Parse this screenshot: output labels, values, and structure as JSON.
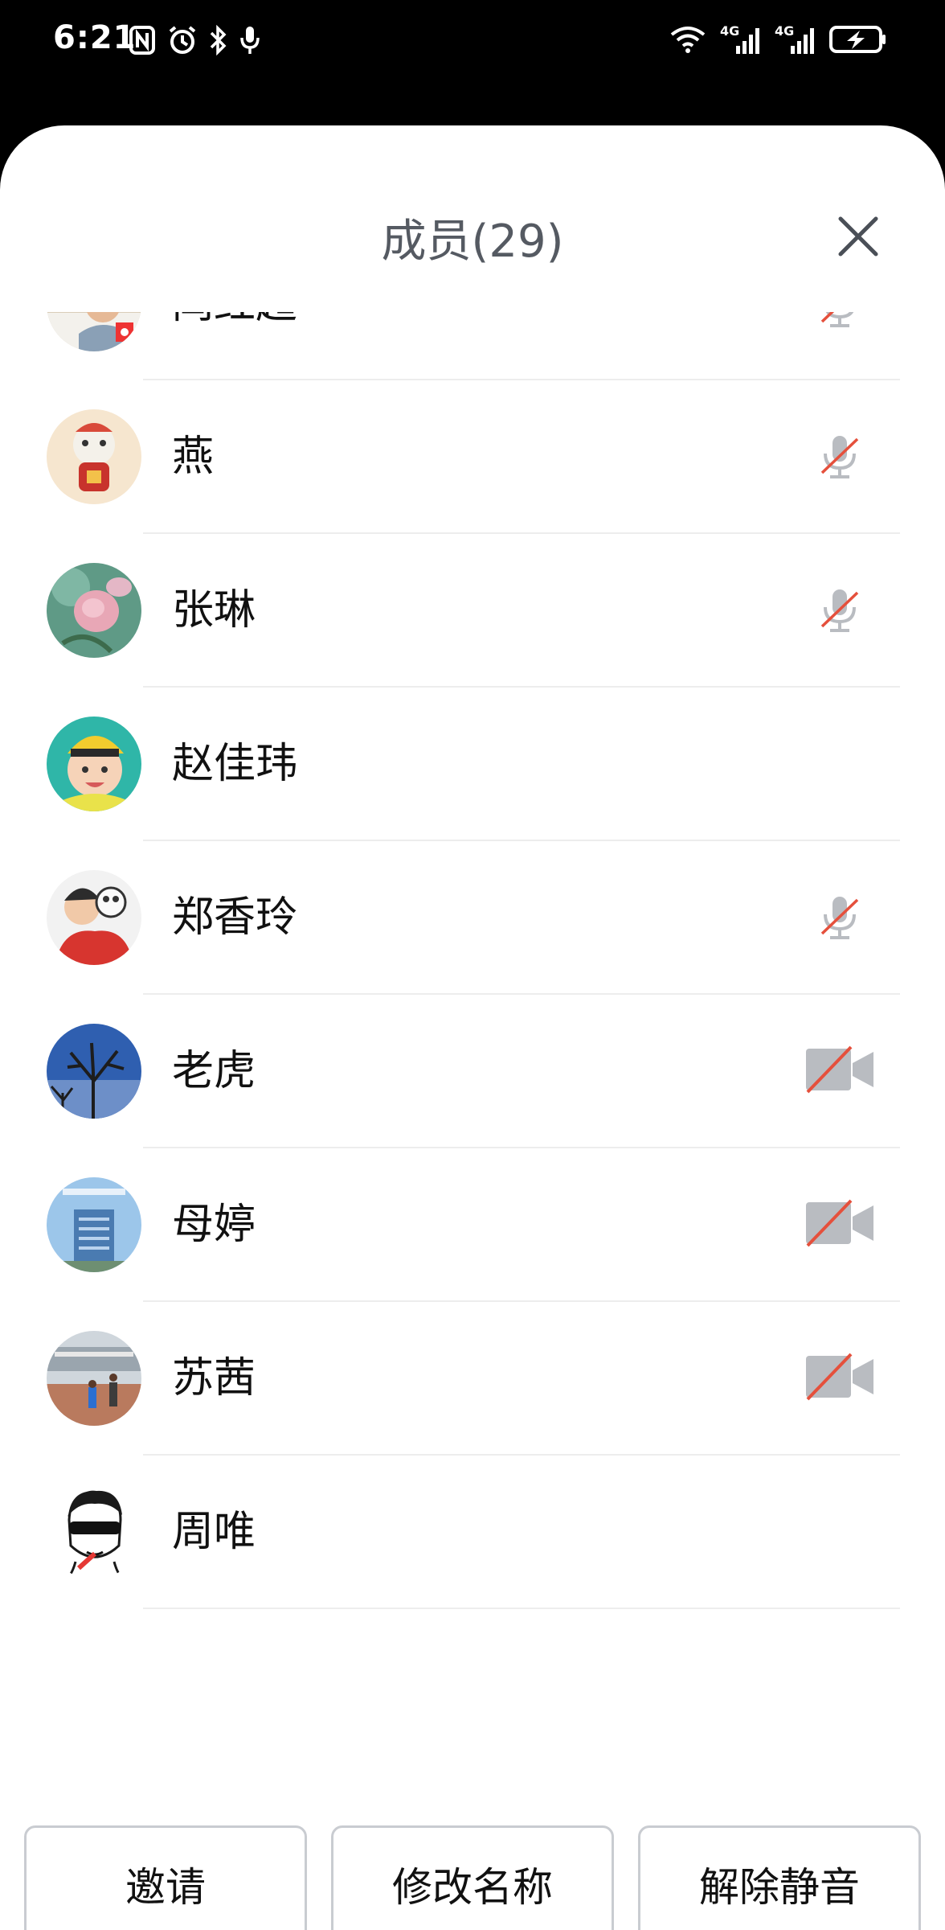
{
  "status_bar": {
    "time": "6:21",
    "left_icons": [
      "nfc-icon",
      "alarm-icon",
      "bluetooth-icon",
      "microphone-icon"
    ],
    "right_icons": [
      "wifi-icon",
      "signal-4g-icon",
      "signal-4g-icon",
      "battery-charging-icon"
    ],
    "network_label_1": "4G",
    "network_label_2": "4G"
  },
  "sheet": {
    "title": "成员(29)",
    "close_icon": "close-icon"
  },
  "members": [
    {
      "name": "闫红超",
      "status_icon": "mic-muted-icon",
      "avatar": "avatar-child-sleeping"
    },
    {
      "name": "燕",
      "status_icon": "mic-muted-icon",
      "avatar": "avatar-cartoon-lion"
    },
    {
      "name": "张琳",
      "status_icon": "mic-muted-icon",
      "avatar": "avatar-pink-roses"
    },
    {
      "name": "赵佳玮",
      "status_icon": "none",
      "avatar": "avatar-baby-yellow-hat"
    },
    {
      "name": "郑香玲",
      "status_icon": "mic-muted-icon",
      "avatar": "avatar-cartoon-kiss"
    },
    {
      "name": "老虎",
      "status_icon": "video-off-icon",
      "avatar": "avatar-trees-blue-sky"
    },
    {
      "name": "母婷",
      "status_icon": "video-off-icon",
      "avatar": "avatar-building"
    },
    {
      "name": "苏茜",
      "status_icon": "video-off-icon",
      "avatar": "avatar-square-people"
    },
    {
      "name": "周唯",
      "status_icon": "none",
      "avatar": "avatar-sunglasses-sketch"
    }
  ],
  "actions": {
    "invite": "邀请",
    "rename": "修改名称",
    "unmute": "解除静音"
  },
  "colors": {
    "title_text": "#555a62",
    "muted_slash": "#e5503c",
    "icon_gray": "#b9bcc1",
    "divider": "#ededed",
    "button_border": "#c9ccd1"
  }
}
